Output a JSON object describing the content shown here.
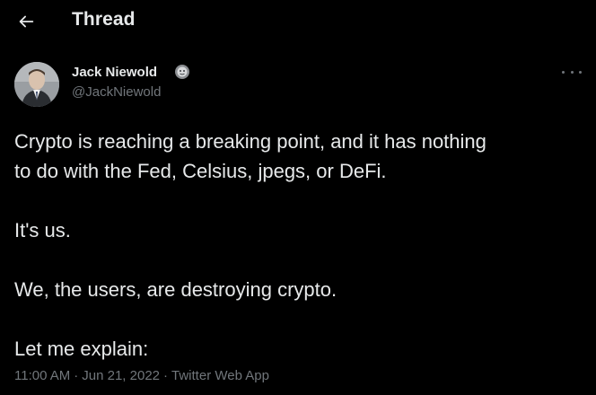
{
  "header": {
    "title": "Thread"
  },
  "author": {
    "name": "Jack Niewold",
    "handle": "@JackNiewold"
  },
  "tweet": {
    "lines": [
      "Crypto is reaching a breaking point, and it has nothing",
      "to do with the Fed, Celsius, jpegs, or DeFi.",
      "It's us.",
      "We, the users, are destroying crypto.",
      "Let me explain:"
    ]
  },
  "meta": {
    "time": "11:00 AM",
    "date": "Jun 21, 2022",
    "source": "Twitter Web App",
    "separator": "·"
  },
  "icons": {
    "back": "arrow-left-icon",
    "verified": "badge-icon",
    "more": "more-horizontal-icon"
  },
  "colors": {
    "background": "#000000",
    "text_primary": "#e7e9ea",
    "text_secondary": "#71767b"
  }
}
